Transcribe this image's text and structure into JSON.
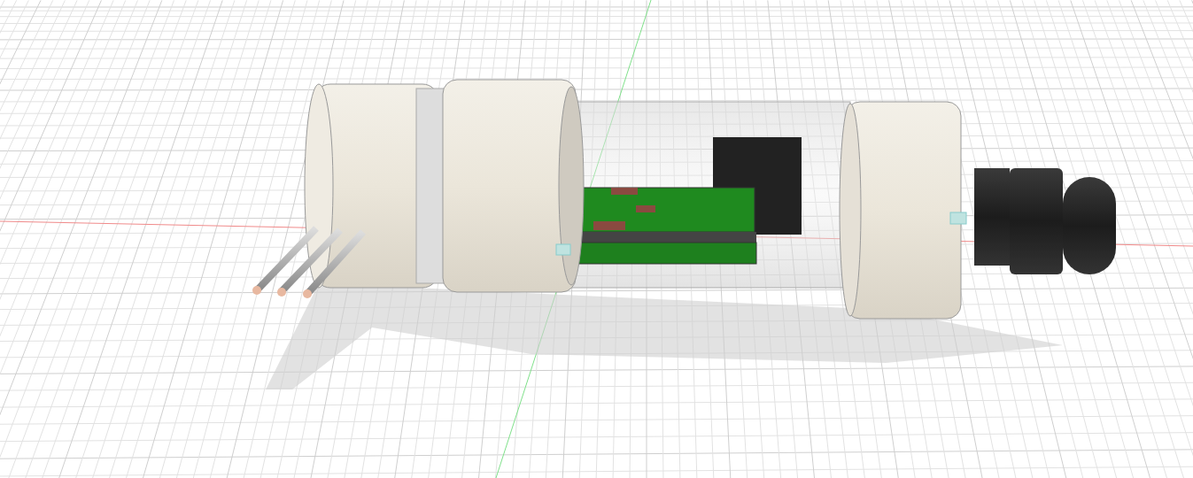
{
  "viewport": {
    "kind": "perspective-grid"
  }
}
